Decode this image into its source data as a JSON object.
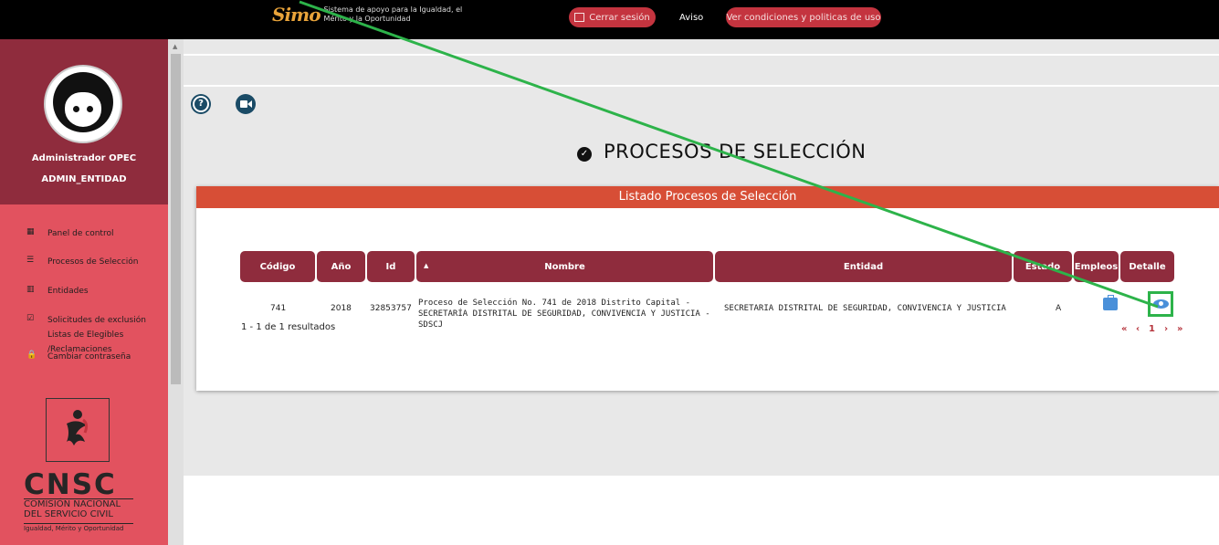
{
  "header": {
    "logo_mark": "Simo",
    "logo_text": "Sistema de apoyo para la Igualdad, el Mérito y la Oportunidad",
    "logout_label": "Cerrar sesión",
    "aviso_label": "Aviso",
    "conditions_label": "Ver condiciones y politicas de uso"
  },
  "sidebar": {
    "user_name": "Administrador OPEC",
    "user_role": "ADMIN_ENTIDAD",
    "items": [
      {
        "label": "Panel de control",
        "icon": "dashboard-icon"
      },
      {
        "label": "Procesos de Selección",
        "icon": "list-icon"
      },
      {
        "label": "Entidades",
        "icon": "building-icon"
      },
      {
        "label": "Solicitudes de exclusión Listas de Elegibles /Reclamaciones",
        "icon": "calendar-check-icon"
      },
      {
        "label": "Cambiar contraseña",
        "icon": "lock-icon"
      }
    ],
    "cnsc": {
      "acronym": "CNSC",
      "name_line1": "COMISIÓN NACIONAL",
      "name_line2": "DEL SERVICIO CIVIL",
      "tagline": "Igualdad, Mérito y Oportunidad"
    }
  },
  "main": {
    "page_title": "PROCESOS DE SELECCIÓN",
    "card_title": "Listado Procesos de Selección",
    "columns": [
      "Código",
      "Año",
      "Id",
      "Nombre",
      "Entidad",
      "Estado",
      "Empleos",
      "Detalle"
    ],
    "rows": [
      {
        "codigo": "741",
        "anio": "2018",
        "id": "32853757",
        "nombre": "Proceso de Selección No. 741 de 2018 Distrito Capital - SECRETARÍA DISTRITAL DE SEGURIDAD, CONVIVENCIA Y JUSTICIA - SDSCJ",
        "entidad": "SECRETARIA DISTRITAL DE SEGURIDAD, CONVIVENCIA Y JUSTICIA",
        "estado": "A"
      }
    ],
    "results_text": "1 - 1 de 1 resultados",
    "pager": {
      "first": "«",
      "prev": "‹",
      "page": "1",
      "next": "›",
      "last": "»"
    }
  },
  "colors": {
    "accent": "#8f2c3d",
    "sidebar_bg": "#e2525f",
    "card_header": "#d74e36",
    "annotation": "#2db34a"
  }
}
